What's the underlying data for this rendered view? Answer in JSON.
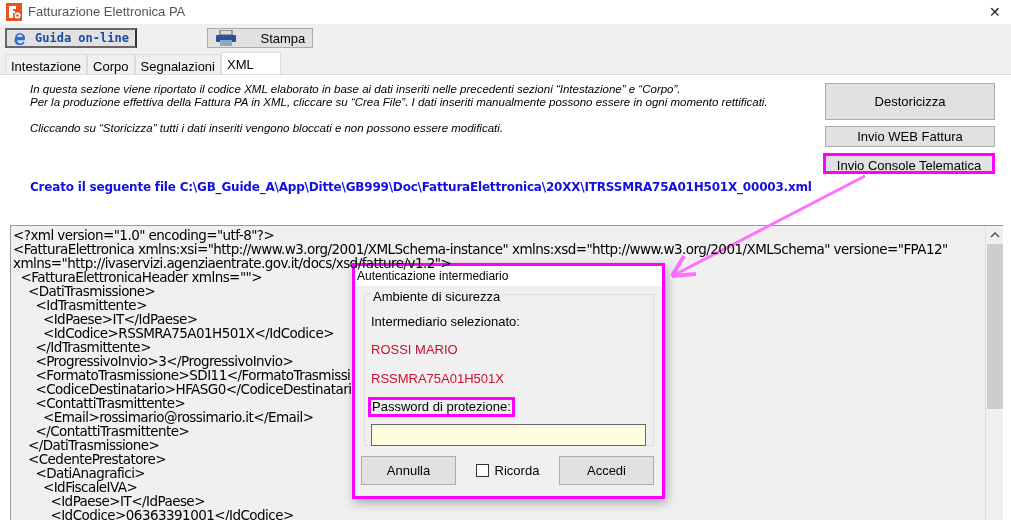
{
  "window": {
    "title": "Fatturazione Elettronica PA",
    "close": "✕"
  },
  "toolbar": [
    {
      "kind": "help",
      "label": "Guida on-line"
    },
    {
      "kind": "print",
      "label": "Stampa"
    }
  ],
  "tabs": [
    {
      "label": "Intestazione",
      "selected": false
    },
    {
      "label": "Corpo",
      "selected": false
    },
    {
      "label": "Segnalazioni",
      "selected": false
    },
    {
      "label": "XML",
      "selected": true
    }
  ],
  "info": [
    "In questa sezione viene riportato il codice XML elaborato in base ai dati inseriti nelle precedenti sezioni “Intestazione” e “Corpo”.",
    "Per la produzione effettiva della Fattura PA in XML, cliccare su “Crea File”. I dati inseriti manualmente possono essere in ogni momento rettificati.",
    "Cliccando su “Storicizza” tutti i dati inseriti vengono bloccati e non possono essere modificati."
  ],
  "side_buttons": [
    {
      "label": "Destoricizza",
      "highlighted": false,
      "kind": "large"
    },
    {
      "label": "Invio WEB Fattura",
      "highlighted": false,
      "kind": "small"
    },
    {
      "label": "Invio Console Telematica",
      "highlighted": true,
      "kind": "small"
    }
  ],
  "file_message": "Creato il seguente file C:\\GB_Guide_A\\App\\Ditte\\GB999\\Doc\\FatturaElettronica\\20XX\\ITRSSMRA75A01H501X_00003.xml",
  "xml_lines": [
    "<?xml version=\"1.0\" encoding=\"utf-8\"?>",
    "<FatturaElettronica xmlns:xsi=\"http://www.w3.org/2001/XMLSchema-instance\" xmlns:xsd=\"http://www.w3.org/2001/XMLSchema\" versione=\"FPA12\"",
    "xmlns=\"http://ivaservizi.agenziaentrate.gov.it/docs/xsd/fatture/v1.2\">",
    "  <FatturaElettronicaHeader xmlns=\"\">",
    "    <DatiTrasmissione>",
    "      <IdTrasmittente>",
    "        <IdPaese>IT</IdPaese>",
    "        <IdCodice>RSSMRA75A01H501X</IdCodice>",
    "      </IdTrasmittente>",
    "      <ProgressivoInvio>3</ProgressivoInvio>",
    "      <FormatoTrasmissione>SDI11</FormatoTrasmissi",
    "      <CodiceDestinatario>HFASG0</CodiceDestinatari",
    "      <ContattiTrasmittente>",
    "        <Email>rossimario@rossimario.it</Email>",
    "      </ContattiTrasmittente>",
    "    </DatiTrasmissione>",
    "    <CedentePrestatore>",
    "      <DatiAnagrafici>",
    "        <IdFiscaleIVA>",
    "          <IdPaese>IT</IdPaese>",
    "          <IdCodice>06363391001</IdCodice>"
  ],
  "dialog": {
    "title": "Autenticazione intermediario",
    "group": "Ambiente di sicurezza",
    "label": "Intermediario selezionato:",
    "name": "ROSSI MARIO",
    "code": "RSSMRA75A01H501X",
    "password_label": "Password di protezione:",
    "password_highlighted": true,
    "buttons": [
      {
        "kind": "button",
        "label": "Annulla"
      },
      {
        "kind": "checkbox",
        "label": "Ricorda",
        "checked": false
      },
      {
        "kind": "button",
        "label": "Accedi"
      }
    ]
  }
}
